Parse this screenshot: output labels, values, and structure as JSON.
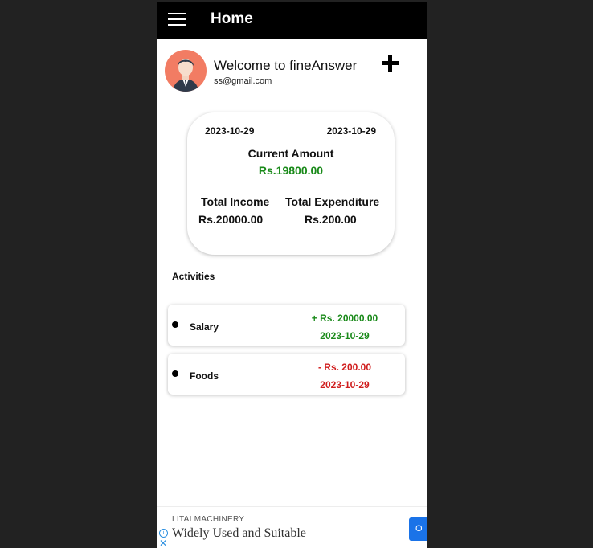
{
  "appbar": {
    "title": "Home"
  },
  "profile": {
    "welcome_text": "Welcome to fineAnswer",
    "email": "ss@gmail.com",
    "avatar_color": "#f27c63"
  },
  "summary": {
    "start_date": "2023-10-29",
    "end_date": "2023-10-29",
    "current_label": "Current Amount",
    "current_value": "Rs.19800.00",
    "income_label": "Total Income",
    "income_value": "Rs.20000.00",
    "expenditure_label": "Total Expenditure",
    "expenditure_value": "Rs.200.00"
  },
  "activities": {
    "title": "Activities",
    "items": [
      {
        "name": "Salary",
        "amount": "+ Rs. 20000.00",
        "date": "2023-10-29",
        "color": "#1a8a1a"
      },
      {
        "name": "Foods",
        "amount": "- Rs. 200.00",
        "date": "2023-10-29",
        "color": "#d01c1c"
      }
    ]
  },
  "ad": {
    "company": "LITAI MACHINERY",
    "headline": "Widely Used and Suitable",
    "cta_label": "O"
  },
  "colors": {
    "income": "#1a8a1a",
    "expense": "#d01c1c",
    "appbar": "#000000"
  }
}
